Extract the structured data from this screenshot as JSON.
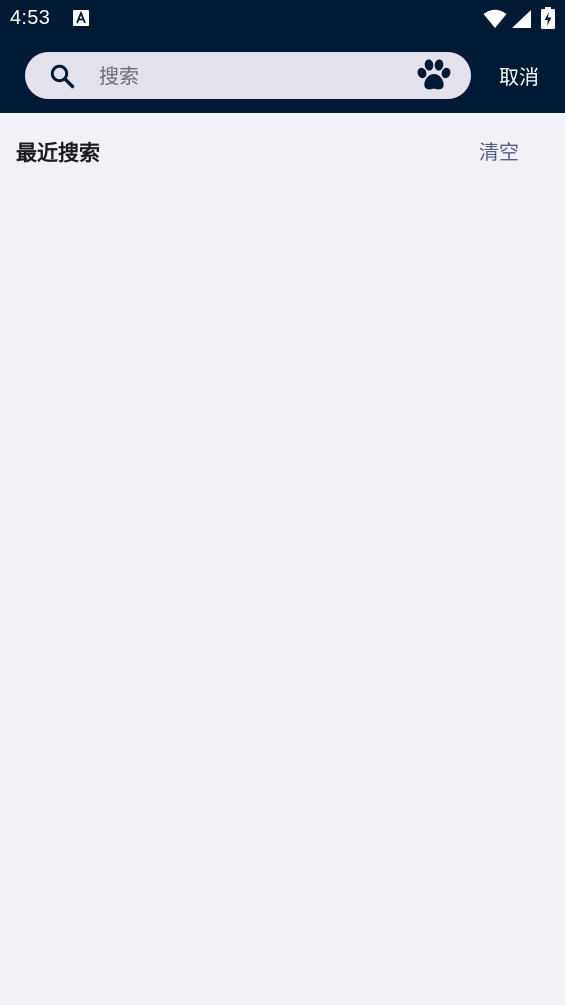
{
  "status_bar": {
    "time": "4:53",
    "icons": [
      "accessibility-a-icon",
      "wifi-icon",
      "signal-icon",
      "battery-charging-icon"
    ]
  },
  "search": {
    "placeholder": "搜索",
    "value": "",
    "cancel_label": "取消"
  },
  "recent": {
    "title": "最近搜索",
    "clear_label": "清空",
    "items": []
  },
  "colors": {
    "header_bg": "#001a33",
    "page_bg": "#f2f1f8",
    "search_bg": "#e3e1ec",
    "accent_text": "#556080"
  }
}
